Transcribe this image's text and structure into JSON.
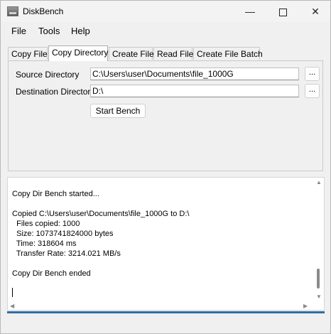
{
  "window": {
    "title": "DiskBench",
    "minimize": "—",
    "close": "✕"
  },
  "menu": [
    "File",
    "Tools",
    "Help"
  ],
  "tabs": [
    "Copy File",
    "Copy Directory",
    "Create File",
    "Read File",
    "Create File Batch"
  ],
  "active_tab": "Copy Directory",
  "form": {
    "source_label": "Source Directory",
    "source_value": "C:\\Users\\user\\Documents\\file_1000G",
    "dest_label": "Destination Directory",
    "dest_value": "D:\\",
    "browse_label": "...",
    "start_label": "Start Bench"
  },
  "output": {
    "lines": [
      "Copy Dir Bench started...",
      "",
      "Copied C:\\Users\\user\\Documents\\file_1000G to D:\\",
      "  Files copied: 1000",
      "  Size: 1073741824000 bytes",
      "  Time: 318604 ms",
      "  Transfer Rate: 3214.021 MB/s",
      "",
      "Copy Dir Bench ended"
    ]
  },
  "colors": {
    "accent": "#2e6ea3"
  },
  "icons": {
    "app": "disk-bench-app-icon",
    "scroll_up": "chevron-up-icon",
    "scroll_down": "chevron-down-icon",
    "scroll_left": "chevron-left-icon",
    "scroll_right": "chevron-right-icon"
  }
}
